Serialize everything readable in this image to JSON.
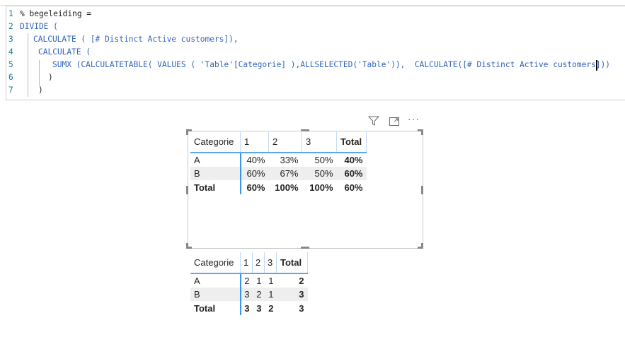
{
  "editor": {
    "lines": [
      {
        "n": "1",
        "text": "% begeleiding ="
      },
      {
        "n": "2",
        "text": "DIVIDE ("
      },
      {
        "n": "3",
        "text": "CALCULATE ( [# Distinct Active customers]),"
      },
      {
        "n": "4",
        "text": "CALCULATE ("
      },
      {
        "n": "5",
        "text": "SUMX (CALCULATETABLE( VALUES ( 'Table'[Categorie] ),ALLSELECTED('Table')),  CALCULATE([# Distinct Active customers]))"
      },
      {
        "n": "6",
        "text": ")"
      },
      {
        "n": "7",
        "text": ")"
      }
    ]
  },
  "visual_header": {
    "icons": [
      "filter-icon",
      "focus-mode-icon",
      "more-options-icon"
    ]
  },
  "matrix1": {
    "headers": [
      "Categorie",
      "1",
      "2",
      "3",
      "Total"
    ],
    "rows": [
      [
        "A",
        "40%",
        "33%",
        "50%",
        "40%"
      ],
      [
        "B",
        "60%",
        "67%",
        "50%",
        "60%"
      ],
      [
        "Total",
        "60%",
        "100%",
        "100%",
        "60%"
      ]
    ]
  },
  "matrix2": {
    "headers": [
      "Categorie",
      "1",
      "2",
      "3",
      "Total"
    ],
    "rows": [
      [
        "A",
        "2",
        "1",
        "1",
        "2"
      ],
      [
        "B",
        "3",
        "2",
        "1",
        "3"
      ],
      [
        "Total",
        "3",
        "3",
        "2",
        "3"
      ]
    ]
  }
}
